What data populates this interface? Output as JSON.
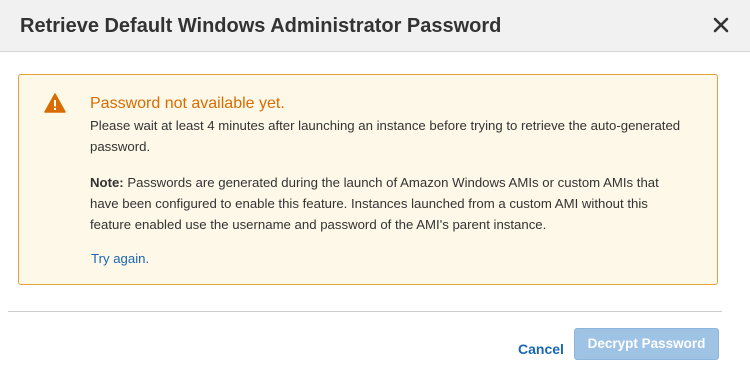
{
  "dialog": {
    "title": "Retrieve Default Windows Administrator Password",
    "close_icon": "close-icon"
  },
  "alert": {
    "icon": "warning-icon",
    "title": "Password not available yet.",
    "message": "Please wait at least 4 minutes after launching an instance before trying to retrieve the auto-generated password.",
    "note_label": "Note:",
    "note_text": " Passwords are generated during the launch of Amazon Windows AMIs or custom AMIs that have been configured to enable this feature. Instances launched from a custom AMI without this feature enabled use the username and password of the AMI's parent instance.",
    "try_again_label": "Try again."
  },
  "footer": {
    "cancel_label": "Cancel",
    "decrypt_label": "Decrypt Password"
  },
  "colors": {
    "alert_background": "#fdf8e8",
    "alert_border": "#e1a33c",
    "alert_title": "#d96c00",
    "link": "#1a66b4",
    "primary_button_disabled": "#9ec3e4"
  }
}
